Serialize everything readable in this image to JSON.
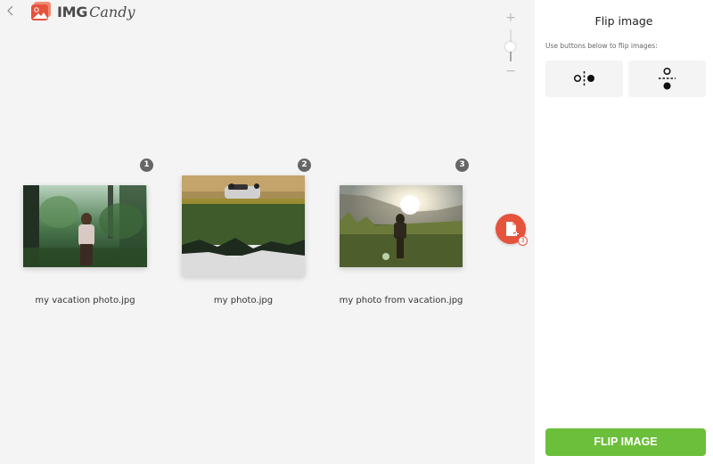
{
  "header": {
    "back_icon": "chevron-left-icon",
    "logo_primary": "IMG",
    "logo_secondary": "Candy",
    "brand_color": "#e5533d"
  },
  "zoom": {
    "plus_label": "+",
    "minus_label": "−",
    "level": 0.45
  },
  "files": [
    {
      "index": "1",
      "name": "my vacation photo.jpg",
      "flipped": "none"
    },
    {
      "index": "2",
      "name": "my photo.jpg",
      "flipped": "vertical"
    },
    {
      "index": "3",
      "name": "my photo from vacation.jpg",
      "flipped": "none"
    }
  ],
  "add_files": {
    "icon": "add-file-icon",
    "count": "3"
  },
  "sidebar": {
    "title": "Flip image",
    "hint": "Use buttons below to flip images:",
    "options": [
      {
        "label": "Flip horizontally",
        "icon": "flip-horizontal-icon"
      },
      {
        "label": "Flip vertically",
        "icon": "flip-vertical-icon"
      }
    ],
    "action_label": "FLIP IMAGE",
    "action_color": "#6bbf3a"
  }
}
